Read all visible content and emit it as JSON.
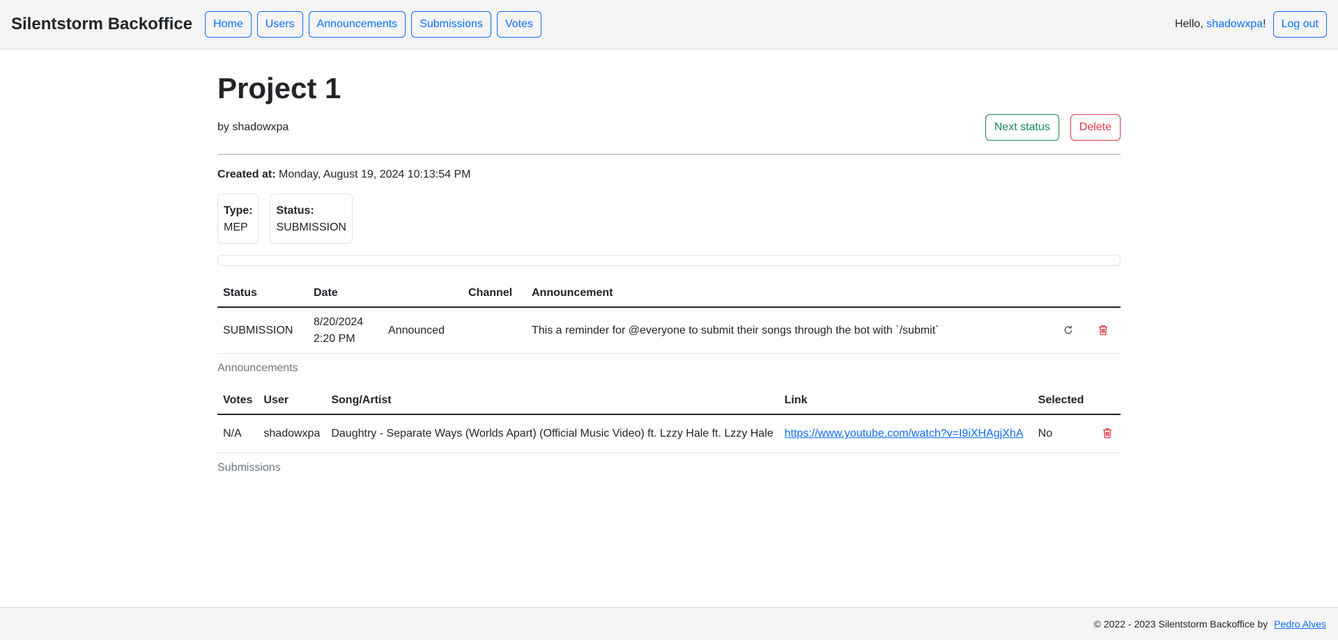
{
  "app": {
    "brand": "Silentstorm Backoffice"
  },
  "nav": {
    "items": [
      {
        "label": "Home"
      },
      {
        "label": "Users"
      },
      {
        "label": "Announcements"
      },
      {
        "label": "Submissions"
      },
      {
        "label": "Votes"
      }
    ],
    "greeting": "Hello, ",
    "username": "shadowxpa",
    "greeting_suffix": "!",
    "logout_label": "Log out"
  },
  "project": {
    "title": "Project 1",
    "byline": "by shadowxpa",
    "next_status_label": "Next status",
    "delete_label": "Delete",
    "created_label": "Created at:",
    "created_value": "Monday, August 19, 2024 10:13:54 PM",
    "type_label": "Type:",
    "type_value": "MEP",
    "status_label": "Status:",
    "status_value": "SUBMISSION",
    "progress_fraction": 0
  },
  "announcements": {
    "headers": [
      "Status",
      "Date",
      "Channel",
      "Announcement"
    ],
    "rows": [
      {
        "status": "SUBMISSION",
        "date_line1": "8/20/2024",
        "date_line2": "2:20 PM",
        "state": "Announced",
        "channel": "",
        "announcement": "This a reminder for @everyone to submit their songs through the bot with `/submit`"
      }
    ],
    "caption": "Announcements"
  },
  "submissions": {
    "headers": [
      "Votes",
      "User",
      "Song/Artist",
      "Link",
      "Selected"
    ],
    "rows": [
      {
        "votes": "N/A",
        "user": "shadowxpa",
        "song": "Daughtry - Separate Ways (Worlds Apart) (Official Music Video) ft. Lzzy Hale ft. Lzzy Hale",
        "link": "https://www.youtube.com/watch?v=I9iXHAgjXhA",
        "selected": "No"
      }
    ],
    "caption": "Submissions"
  },
  "footer": {
    "text": "© 2022 - 2023 Silentstorm Backoffice by",
    "author": "Pedro Alves"
  },
  "colors": {
    "primary": "#0d6efd",
    "success": "#198754",
    "danger": "#dc3545",
    "muted": "#6c757d"
  }
}
